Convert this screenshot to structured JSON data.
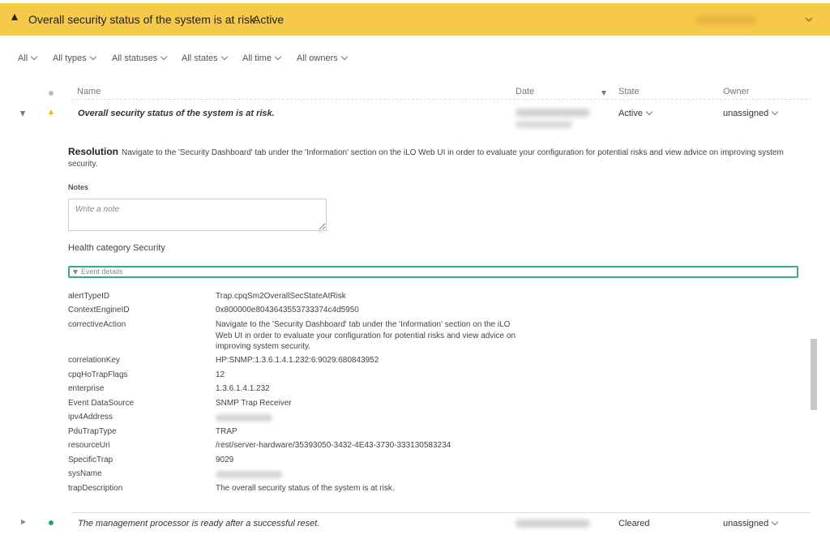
{
  "banner": {
    "title": "Overall security status of the system is at risk.",
    "status": "Active",
    "bg_color": "#f7c948"
  },
  "filters": [
    "All",
    "All types",
    "All statuses",
    "All states",
    "All time",
    "All owners"
  ],
  "table": {
    "headers": {
      "name": "Name",
      "date": "Date",
      "state": "State",
      "owner": "Owner"
    }
  },
  "alert": {
    "name": "Overall security status of the system is at risk.",
    "state": "Active",
    "owner": "unassigned",
    "severity_icon": "warning-icon",
    "resolution_label": "Resolution",
    "resolution_text": "Navigate to the 'Security Dashboard' tab under the 'Information' section on the iLO Web UI in order to evaluate your configuration for potential risks and view advice on improving system security.",
    "notes_label": "Notes",
    "notes_placeholder": "Write a note",
    "health_category": "Health category Security",
    "event_details_label": "Event details"
  },
  "event_details": [
    {
      "key": "alertTypeID",
      "value": "Trap.cpqSm2OverallSecStateAtRisk"
    },
    {
      "key": "ContextEngineID",
      "value": "0x800000e8043643553733374c4d5950"
    },
    {
      "key": "correctiveAction",
      "value": "Navigate to the 'Security Dashboard' tab under the 'Information' section on the iLO Web UI in order to evaluate your configuration for potential risks and view advice on improving system security."
    },
    {
      "key": "correlationKey",
      "value": "HP:SNMP:1.3.6.1.4.1.232:6:9029:680843952"
    },
    {
      "key": "cpqHoTrapFlags",
      "value": "12"
    },
    {
      "key": "enterprise",
      "value": "1.3.6.1.4.1.232"
    },
    {
      "key": "Event DataSource",
      "value": "SNMP Trap Receiver"
    },
    {
      "key": "ipv4Address",
      "value": ""
    },
    {
      "key": "PduTrapType",
      "value": "TRAP"
    },
    {
      "key": "resourceUri",
      "value": "/rest/server-hardware/35393050-3432-4E43-3730-333130583234"
    },
    {
      "key": "SpecificTrap",
      "value": "9029"
    },
    {
      "key": "sysName",
      "value": ""
    },
    {
      "key": "trapDescription",
      "value": "The overall security status of the system is at risk."
    }
  ],
  "next_alert": {
    "name": "The management processor is ready after a successful reset.",
    "state": "Cleared",
    "owner": "unassigned",
    "severity_icon": "ok-dot-icon",
    "status_color": "#1aaa6e"
  },
  "colors": {
    "accent": "#3aa890",
    "warning": "#f0b400"
  }
}
